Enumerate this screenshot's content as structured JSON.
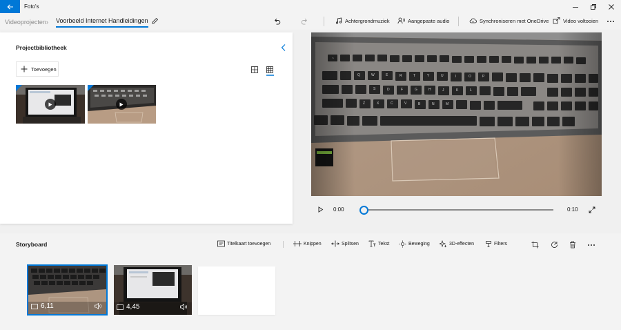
{
  "app": {
    "title": "Foto's"
  },
  "breadcrumb": {
    "root": "Videoprojecten",
    "separator": "›",
    "current": "Voorbeeld Internet Handleidingen"
  },
  "toolbar": {
    "background_music": "Achtergrondmuziek",
    "custom_audio": "Aangepaste audio",
    "sync_onedrive": "Synchroniseren met OneDrive",
    "finish_video": "Video voltooien"
  },
  "library": {
    "title": "Projectbibliotheek",
    "add_label": "Toevoegen"
  },
  "player": {
    "current_time": "0:00",
    "total_time": "0:10",
    "progress": 0
  },
  "storyboard": {
    "title": "Storyboard",
    "tools": {
      "title_card": "Titelkaart toevoegen",
      "trim": "Knippen",
      "split": "Splitsen",
      "text": "Tekst",
      "motion": "Beweging",
      "effects_3d": "3D-effecten",
      "filters": "Filters"
    },
    "clips": [
      {
        "duration": "6,11",
        "selected": true
      },
      {
        "duration": "4,45",
        "selected": false
      }
    ]
  },
  "colors": {
    "accent": "#0078d7"
  }
}
